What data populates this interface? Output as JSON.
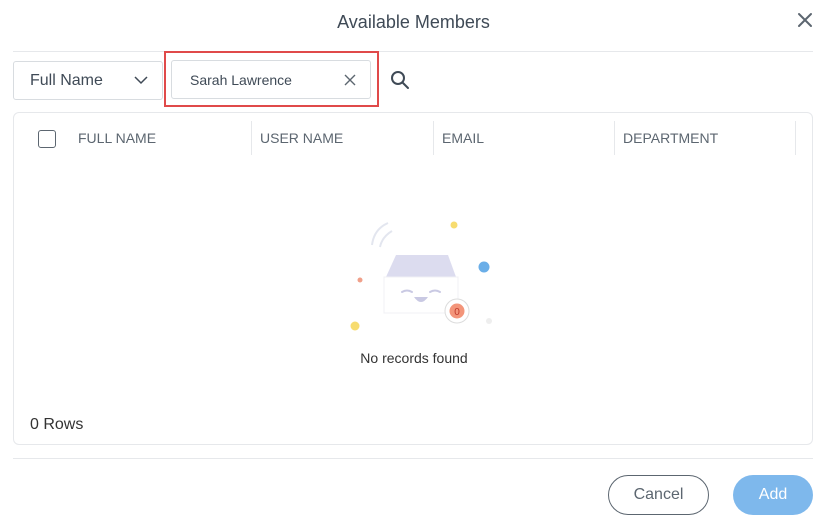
{
  "dialog": {
    "title": "Available Members",
    "close_icon": "close-icon"
  },
  "filter": {
    "field_select": {
      "selected": "Full Name",
      "icon": "chevron-down-icon"
    },
    "search_input": {
      "value": "Sarah Lawrence",
      "clear_icon": "clear-icon"
    },
    "search_button_icon": "search-icon",
    "highlight_color": "#e04a4a"
  },
  "grid": {
    "columns": [
      "FULL NAME",
      "USER NAME",
      "EMAIL",
      "DEPARTMENT"
    ],
    "empty_state": {
      "icon": "empty-box-illustration",
      "badge": "0",
      "message": "No records found"
    },
    "rows_count": "0 Rows"
  },
  "footer": {
    "cancel_label": "Cancel",
    "add_label": "Add",
    "accent": "#7eb8ec"
  }
}
